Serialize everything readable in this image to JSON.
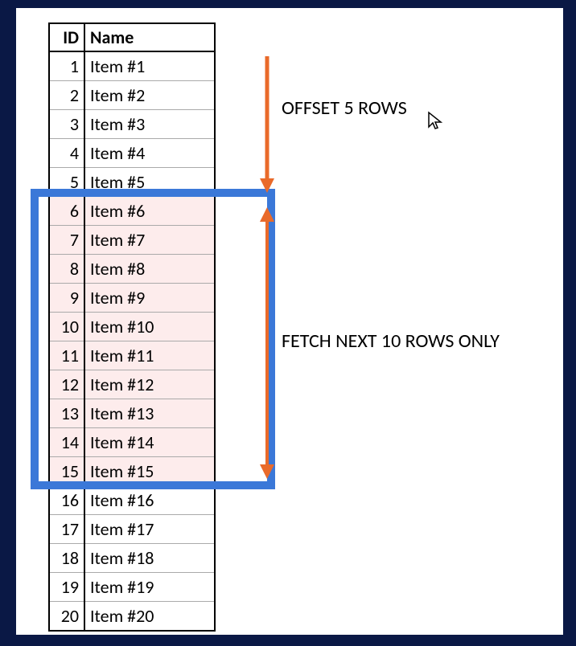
{
  "table": {
    "headers": {
      "id": "ID",
      "name": "Name"
    },
    "rows": [
      {
        "id": "1",
        "name": "Item #1"
      },
      {
        "id": "2",
        "name": "Item #2"
      },
      {
        "id": "3",
        "name": "Item #3"
      },
      {
        "id": "4",
        "name": "Item #4"
      },
      {
        "id": "5",
        "name": "Item #5"
      },
      {
        "id": "6",
        "name": "Item #6"
      },
      {
        "id": "7",
        "name": "Item #7"
      },
      {
        "id": "8",
        "name": "Item #8"
      },
      {
        "id": "9",
        "name": "Item #9"
      },
      {
        "id": "10",
        "name": "Item #10"
      },
      {
        "id": "11",
        "name": "Item #11"
      },
      {
        "id": "12",
        "name": "Item #12"
      },
      {
        "id": "13",
        "name": "Item #13"
      },
      {
        "id": "14",
        "name": "Item #14"
      },
      {
        "id": "15",
        "name": "Item #15"
      },
      {
        "id": "16",
        "name": "Item #16"
      },
      {
        "id": "17",
        "name": "Item #17"
      },
      {
        "id": "18",
        "name": "Item #18"
      },
      {
        "id": "19",
        "name": "Item #19"
      },
      {
        "id": "20",
        "name": "Item #20"
      }
    ],
    "highlight_start": 5,
    "highlight_count": 10
  },
  "labels": {
    "offset": "OFFSET 5 ROWS",
    "fetch": "FETCH NEXT 10 ROWS ONLY"
  },
  "colors": {
    "arrow": "#e96a2a",
    "highlight_box": "#3b78d8",
    "highlight_fill": "#fdecec"
  }
}
